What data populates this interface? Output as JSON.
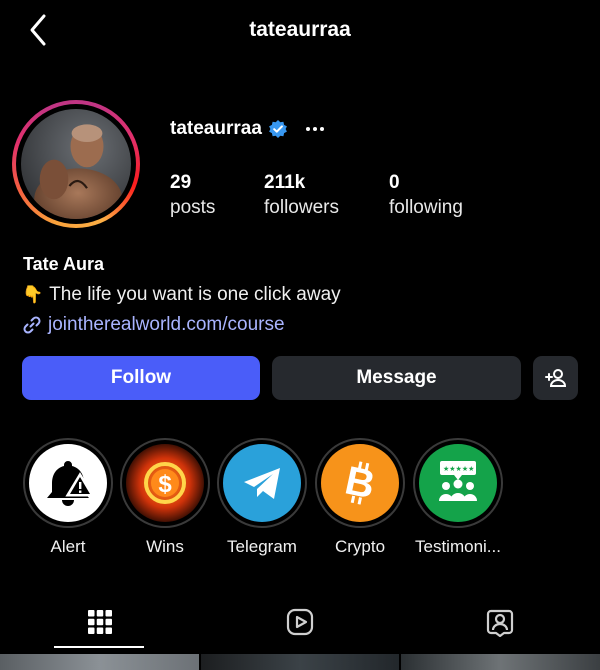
{
  "header": {
    "title": "tateaurraa",
    "back_icon": "chevron-left-icon"
  },
  "profile": {
    "username": "tateaurraa",
    "verified_icon": "verified-badge-icon",
    "more_icon": "more-horizontal-icon",
    "stats": [
      {
        "value": "29",
        "label": "posts"
      },
      {
        "value": "211k",
        "label": "followers"
      },
      {
        "value": "0",
        "label": "following"
      }
    ]
  },
  "bio": {
    "name": "Tate Aura",
    "line": "The life you want is one click away",
    "line_emoji": "👇",
    "link": "jointherealworld.com/course",
    "link_icon": "link-icon"
  },
  "actions": {
    "follow_label": "Follow",
    "message_label": "Message",
    "add_user_icon": "add-person-icon"
  },
  "highlights": [
    {
      "label": "Alert",
      "icon": "bell-warning-icon"
    },
    {
      "label": "Wins",
      "icon": "dollar-fire-icon"
    },
    {
      "label": "Telegram",
      "icon": "telegram-icon"
    },
    {
      "label": "Crypto",
      "icon": "bitcoin-icon"
    },
    {
      "label": "Testimoni...",
      "icon": "reviews-icon"
    }
  ],
  "tabs": [
    {
      "name": "posts-grid",
      "icon": "grid-icon",
      "active": true
    },
    {
      "name": "reels",
      "icon": "reels-icon",
      "active": false
    },
    {
      "name": "tagged",
      "icon": "tagged-person-icon",
      "active": false
    }
  ],
  "colors": {
    "background": "#000000",
    "follow_button": "#4a5df9",
    "secondary_button": "#26292e",
    "link": "#a9b4ff",
    "verified": "#3897f0"
  }
}
